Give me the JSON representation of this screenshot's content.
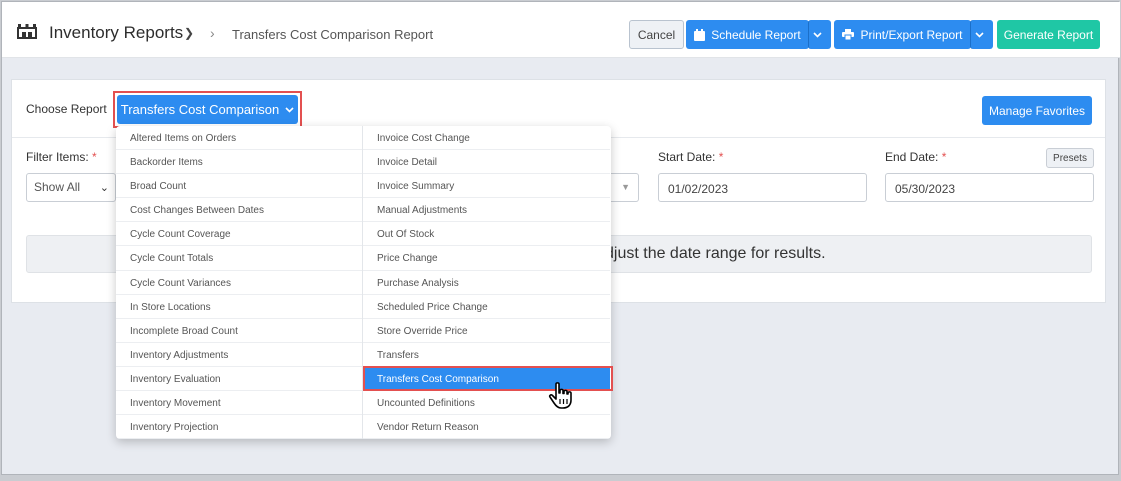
{
  "header": {
    "title": "Inventory Reports",
    "breadcrumb": "Transfers Cost Comparison Report",
    "buttons": {
      "cancel": "Cancel",
      "schedule": "Schedule Report",
      "print_export": "Print/Export Report",
      "generate": "Generate Report"
    }
  },
  "report_chooser": {
    "label": "Choose Report",
    "selected": "Transfers Cost Comparison",
    "manage_favorites": "Manage Favorites"
  },
  "filters": {
    "filter_items_label": "Filter Items:",
    "filter_items_value": "Show All",
    "start_date_label": "Start Date:",
    "start_date_value": "01/02/2023",
    "end_date_label": "End Date:",
    "end_date_value": "05/30/2023",
    "required_mark": "*",
    "presets": "Presets"
  },
  "message": "djust the date range for results.",
  "dropdown": {
    "left": [
      "Altered Items on Orders",
      "Backorder Items",
      "Broad Count",
      "Cost Changes Between Dates",
      "Cycle Count Coverage",
      "Cycle Count Totals",
      "Cycle Count Variances",
      "In Store Locations",
      "Incomplete Broad Count",
      "Inventory Adjustments",
      "Inventory Evaluation",
      "Inventory Movement",
      "Inventory Projection"
    ],
    "right": [
      "Invoice Cost Change",
      "Invoice Detail",
      "Invoice Summary",
      "Manual Adjustments",
      "Out Of Stock",
      "Price Change",
      "Purchase Analysis",
      "Scheduled Price Change",
      "Store Override Price",
      "Transfers",
      "Transfers Cost Comparison",
      "Uncounted Definitions",
      "Vendor Return Reason"
    ],
    "selected_item": "Transfers Cost Comparison"
  },
  "colors": {
    "primary": "#2d8cf0",
    "success": "#1fc7a5",
    "required": "#e35050",
    "highlight_outline": "#e35050"
  }
}
